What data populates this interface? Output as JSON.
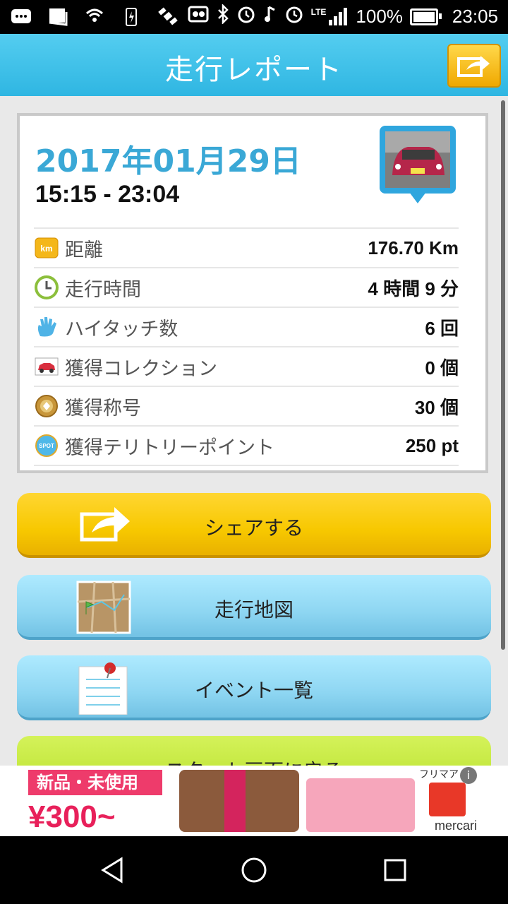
{
  "status_bar": {
    "battery": "100%",
    "time": "23:05",
    "net": "LTE"
  },
  "header": {
    "title": "走行レポート"
  },
  "report": {
    "date": "2017年01月29日",
    "time_range": "15:15 - 23:04",
    "rows": [
      {
        "icon": "km-icon",
        "label": "距離",
        "value": "176.70 Km"
      },
      {
        "icon": "clock-icon",
        "label": "走行時間",
        "value": "4 時間 9 分"
      },
      {
        "icon": "hand-icon",
        "label": "ハイタッチ数",
        "value": "6 回"
      },
      {
        "icon": "car-icon",
        "label": "獲得コレクション",
        "value": "0 個"
      },
      {
        "icon": "medal-icon",
        "label": "獲得称号",
        "value": "30 個"
      },
      {
        "icon": "spot-icon",
        "label": "獲得テリトリーポイント",
        "value": "250 pt"
      }
    ],
    "km_badge": "km",
    "spot_badge": "SPOT"
  },
  "buttons": {
    "share": "シェアする",
    "map": "走行地図",
    "events": "イベント一覧",
    "back": "スタート画面に戻る"
  },
  "ad": {
    "tag": "新品・未使用",
    "price": "¥300~",
    "brand": "mercari",
    "mark": "フリマア"
  },
  "colors": {
    "header": "#2fb6e2",
    "date": "#3aa8d6",
    "share_button": "#f7c800",
    "nav_button": "#8ed6f2",
    "back_button": "#b8e02a"
  }
}
